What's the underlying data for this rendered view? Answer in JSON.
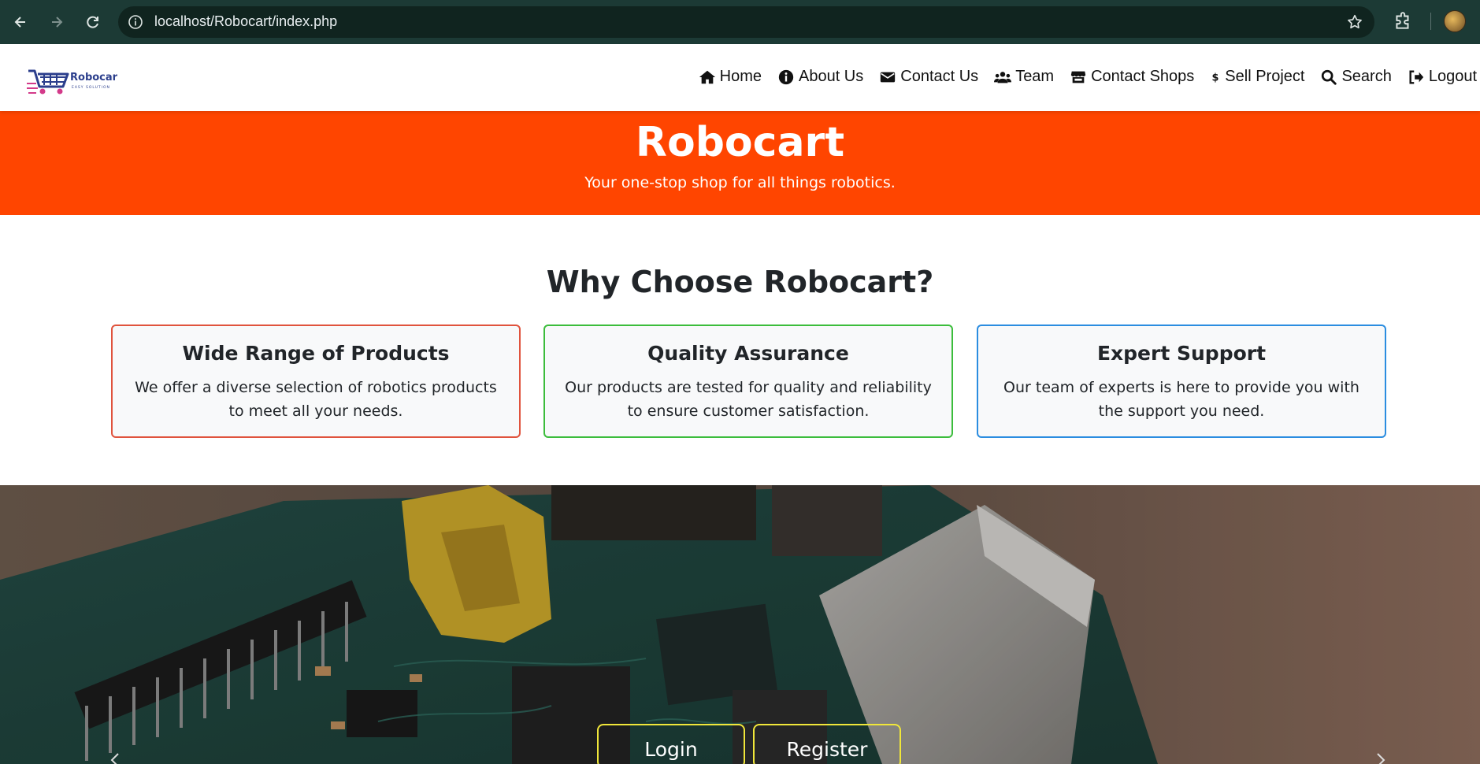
{
  "browser": {
    "url": "localhost/Robocart/index.php"
  },
  "navbar": {
    "logo_text": "Robocart",
    "logo_sub": "EASY SOLUTION",
    "links": [
      {
        "label": "Home",
        "icon": "home-icon"
      },
      {
        "label": "About Us",
        "icon": "info-icon"
      },
      {
        "label": "Contact Us",
        "icon": "envelope-icon"
      },
      {
        "label": "Team",
        "icon": "users-icon"
      },
      {
        "label": "Contact Shops",
        "icon": "store-icon"
      },
      {
        "label": "Sell Project",
        "icon": "dollar-icon"
      },
      {
        "label": "Search",
        "icon": "search-icon"
      },
      {
        "label": "Logout",
        "icon": "logout-icon"
      }
    ]
  },
  "hero": {
    "title": "Robocart",
    "subtitle": "Your one-stop shop for all things robotics."
  },
  "why": {
    "title": "Why Choose Robocart?",
    "cards": [
      {
        "title": "Wide Range of Products",
        "text": "We offer a diverse selection of robotics products to meet all your needs.",
        "border": "#e0533d"
      },
      {
        "title": "Quality Assurance",
        "text": "Our products are tested for quality and reliability to ensure customer satisfaction.",
        "border": "#3cbd3c"
      },
      {
        "title": "Expert Support",
        "text": "Our team of experts is here to provide you with the support you need.",
        "border": "#2b8de0"
      }
    ]
  },
  "banner": {
    "login_label": "Login",
    "register_label": "Register"
  },
  "colors": {
    "accent": "#ff4500",
    "chrome": "#1c3a35"
  }
}
